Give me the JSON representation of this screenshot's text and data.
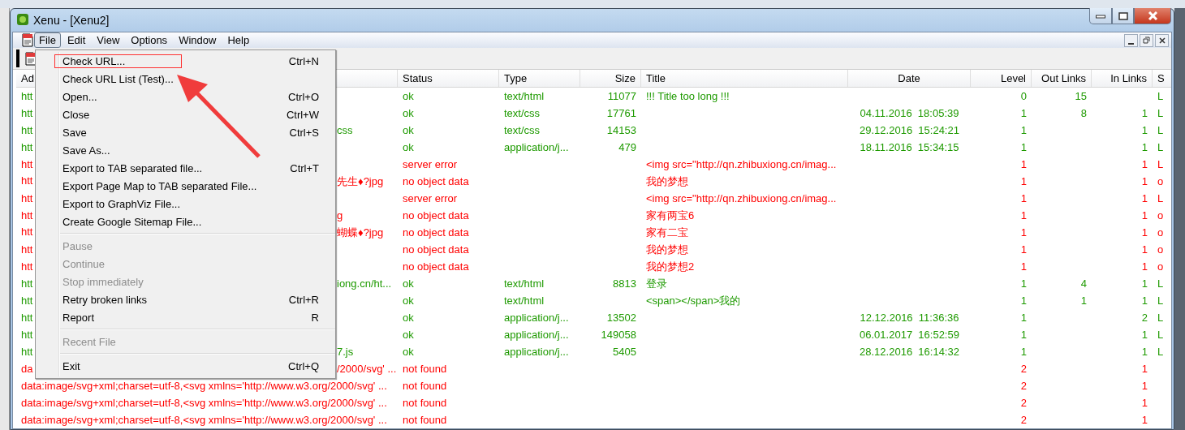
{
  "window": {
    "title": "Xenu - [Xenu2]"
  },
  "menubar": [
    {
      "label": "File",
      "selected": true
    },
    {
      "label": "Edit",
      "selected": false
    },
    {
      "label": "View",
      "selected": false
    },
    {
      "label": "Options",
      "selected": false
    },
    {
      "label": "Window",
      "selected": false
    },
    {
      "label": "Help",
      "selected": false
    }
  ],
  "file_menu": [
    {
      "kind": "item",
      "label": "Check URL...",
      "shortcut": "Ctrl+N",
      "disabled": false,
      "highlighted": true
    },
    {
      "kind": "item",
      "label": "Check URL List (Test)...",
      "disabled": false,
      "highlighted": false
    },
    {
      "kind": "item",
      "label": "Open...",
      "shortcut": "Ctrl+O",
      "disabled": false,
      "highlighted": false
    },
    {
      "kind": "item",
      "label": "Close",
      "shortcut": "Ctrl+W",
      "disabled": false,
      "highlighted": false
    },
    {
      "kind": "item",
      "label": "Save",
      "shortcut": "Ctrl+S",
      "disabled": false,
      "highlighted": false
    },
    {
      "kind": "item",
      "label": "Save As...",
      "disabled": false,
      "highlighted": false
    },
    {
      "kind": "item",
      "label": "Export to TAB separated file...",
      "shortcut": "Ctrl+T",
      "disabled": false,
      "highlighted": false
    },
    {
      "kind": "item",
      "label": "Export Page Map to TAB separated File...",
      "disabled": false,
      "highlighted": false
    },
    {
      "kind": "item",
      "label": "Export to GraphViz File...",
      "disabled": false,
      "highlighted": false
    },
    {
      "kind": "item",
      "label": "Create Google Sitemap File...",
      "disabled": false,
      "highlighted": false
    },
    {
      "kind": "separator"
    },
    {
      "kind": "item",
      "label": "Pause",
      "disabled": true,
      "highlighted": false
    },
    {
      "kind": "item",
      "label": "Continue",
      "disabled": true,
      "highlighted": false
    },
    {
      "kind": "item",
      "label": "Stop immediately",
      "disabled": true,
      "highlighted": false
    },
    {
      "kind": "item",
      "label": "Retry broken links",
      "shortcut": "Ctrl+R",
      "disabled": false,
      "highlighted": false
    },
    {
      "kind": "item",
      "label": "Report",
      "shortcut": "R",
      "disabled": false,
      "highlighted": false
    },
    {
      "kind": "separator"
    },
    {
      "kind": "item",
      "label": "Recent File",
      "disabled": true,
      "highlighted": false
    },
    {
      "kind": "separator"
    },
    {
      "kind": "item",
      "label": "Exit",
      "shortcut": "Ctrl+Q",
      "disabled": false,
      "highlighted": false
    }
  ],
  "table": {
    "columns": [
      "Ad",
      "Status",
      "Type",
      "Size",
      "Title",
      "Date",
      "Level",
      "Out Links",
      "In Links",
      "S"
    ],
    "rows": [
      {
        "color": "#1e9a00",
        "address_start": "htt",
        "status": "ok",
        "type": "text/html",
        "size": "11077",
        "title": "!!! Title too long !!!",
        "link_level": "0",
        "out_links": "15",
        "column_11": "L"
      },
      {
        "color": "#1e9a00",
        "address_start": "htt",
        "status": "ok",
        "type": "text/css",
        "size": "17761",
        "date": "04.11.2016  18:05:39",
        "link_level": "1",
        "out_links": "8",
        "in_links": "1",
        "column_11": "L"
      },
      {
        "color": "#1e9a00",
        "address_start": "htt",
        "address_end": "css",
        "status": "ok",
        "type": "text/css",
        "size": "14153",
        "date": "29.12.2016  15:24:21",
        "link_level": "1",
        "in_links": "1",
        "column_11": "L"
      },
      {
        "color": "#1e9a00",
        "address_start": "htt",
        "status": "ok",
        "type": "application/j...",
        "size": "479",
        "date": "18.11.2016  15:34:15",
        "link_level": "1",
        "in_links": "1",
        "column_11": "L"
      },
      {
        "color": "#ff0000",
        "address_start": "htt",
        "status": "server error",
        "title": "<img src=\"http://qn.zhibuxiong.cn/imag...",
        "link_level": "1",
        "in_links": "1",
        "column_11": "L"
      },
      {
        "color": "#ff0000",
        "address_start": "htt",
        "address_end": "先生♦?jpg",
        "status": "no object data",
        "title": "我的梦想",
        "link_level": "1",
        "in_links": "1",
        "column_11": "o"
      },
      {
        "color": "#ff0000",
        "address_start": "htt",
        "status": "server error",
        "title": "<img src=\"http://qn.zhibuxiong.cn/imag...",
        "link_level": "1",
        "in_links": "1",
        "column_11": "L"
      },
      {
        "color": "#ff0000",
        "address_start": "htt",
        "address_end": "g",
        "status": "no object data",
        "title": "家有两宝6",
        "link_level": "1",
        "in_links": "1",
        "column_11": "o"
      },
      {
        "color": "#ff0000",
        "address_start": "htt",
        "address_end": "蝴蝶♦?jpg",
        "status": "no object data",
        "title": "家有二宝",
        "link_level": "1",
        "in_links": "1",
        "column_11": "o"
      },
      {
        "color": "#ff0000",
        "address_start": "htt",
        "status": "no object data",
        "title": "我的梦想",
        "link_level": "1",
        "in_links": "1",
        "column_11": "o"
      },
      {
        "color": "#ff0000",
        "address_start": "htt",
        "status": "no object data",
        "title": "我的梦想2",
        "link_level": "1",
        "in_links": "1",
        "column_11": "o"
      },
      {
        "color": "#1e9a00",
        "address_start": "htt",
        "address_end": "iong.cn/ht...",
        "status": "ok",
        "type": "text/html",
        "size": "8813",
        "title": "登录",
        "link_level": "1",
        "out_links": "4",
        "in_links": "1",
        "column_11": "L"
      },
      {
        "color": "#1e9a00",
        "address_start": "htt",
        "status": "ok",
        "type": "text/html",
        "title": "<span></span>我的",
        "link_level": "1",
        "out_links": "1",
        "in_links": "1",
        "column_11": "L"
      },
      {
        "color": "#1e9a00",
        "address_start": "htt",
        "status": "ok",
        "type": "application/j...",
        "size": "13502",
        "date": "12.12.2016  11:36:36",
        "link_level": "1",
        "in_links": "2",
        "column_11": "L"
      },
      {
        "color": "#1e9a00",
        "address_start": "htt",
        "status": "ok",
        "type": "application/j...",
        "size": "149058",
        "date": "06.01.2017  16:52:59",
        "link_level": "1",
        "in_links": "1",
        "column_11": "L"
      },
      {
        "color": "#1e9a00",
        "address_start": "htt",
        "address_end": "7.js",
        "status": "ok",
        "type": "application/j...",
        "size": "5405",
        "date": "28.12.2016  16:14:32",
        "link_level": "1",
        "in_links": "1",
        "column_11": "L"
      },
      {
        "color": "#ff0000",
        "address_start": "da",
        "address_end": "/2000/svg' ...",
        "status": "not found",
        "link_level": "2",
        "in_links": "1"
      },
      {
        "color": "#ff0000",
        "address_start": "data:image/svg+xml;charset=utf-8,<svg xmlns='http://www.w3.org/2000/svg' ...",
        "status": "not found",
        "link_level": "2",
        "in_links": "1"
      },
      {
        "color": "#ff0000",
        "address_start": "data:image/svg+xml;charset=utf-8,<svg xmlns='http://www.w3.org/2000/svg' ...",
        "status": "not found",
        "link_level": "2",
        "in_links": "1"
      },
      {
        "color": "#ff0000",
        "address_start": "data:image/svg+xml;charset=utf-8,<svg xmlns='http://www.w3.org/2000/svg' ...",
        "status": "not found",
        "link_level": "2",
        "in_links": "1"
      }
    ]
  }
}
